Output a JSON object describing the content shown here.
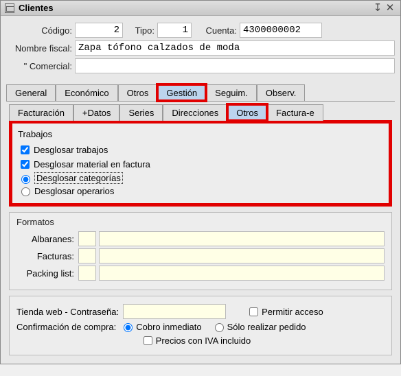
{
  "window": {
    "title": "Clientes"
  },
  "header": {
    "codigo_label": "Código:",
    "codigo_value": "2",
    "tipo_label": "Tipo:",
    "tipo_value": "1",
    "cuenta_label": "Cuenta:",
    "cuenta_value": "4300000002",
    "nombre_fiscal_label": "Nombre fiscal:",
    "nombre_fiscal_value": "Zapa tófono calzados de moda",
    "comercial_label": "\"  Comercial:",
    "comercial_value": ""
  },
  "tabs_main": {
    "items": [
      {
        "label": "General"
      },
      {
        "label": "Económico"
      },
      {
        "label": "Otros"
      },
      {
        "label": "Gestión"
      },
      {
        "label": "Seguim."
      },
      {
        "label": "Observ."
      }
    ]
  },
  "tabs_sub": {
    "items": [
      {
        "label": "Facturación"
      },
      {
        "label": "+Datos"
      },
      {
        "label": "Series"
      },
      {
        "label": "Direcciones"
      },
      {
        "label": "Otros"
      },
      {
        "label": "Factura-e"
      }
    ]
  },
  "trabajos": {
    "title": "Trabajos",
    "desglosar_trabajos": "Desglosar trabajos",
    "desglosar_material": "Desglosar material en factura",
    "desglosar_categorias": "Desglosar categorías",
    "desglosar_operarios": "Desglosar operarios"
  },
  "formatos": {
    "title": "Formatos",
    "albaranes_label": "Albaranes:",
    "facturas_label": "Facturas:",
    "packing_label": "Packing list:"
  },
  "tienda": {
    "title_label": "Tienda web - Contraseña:",
    "password_value": "",
    "permitir_acceso": "Permitir acceso",
    "confirmacion_label": "Confirmación de compra:",
    "cobro_inmediato": "Cobro inmediato",
    "solo_realizar": "Sólo realizar pedido",
    "precios_iva": "Precios con IVA incluido"
  }
}
